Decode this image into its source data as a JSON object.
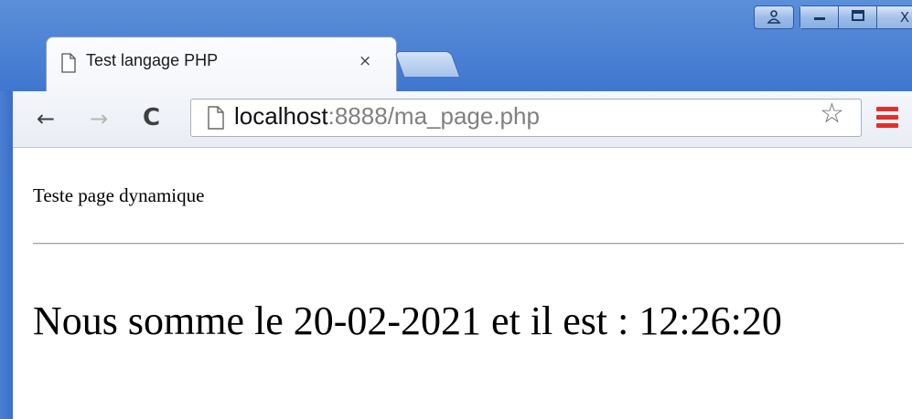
{
  "browser": {
    "tab": {
      "title": "Test langage PHP",
      "close_glyph": "×"
    },
    "url": {
      "host": "localhost",
      "rest": ":8888/ma_page.php"
    },
    "icons": {
      "back": "←",
      "forward": "→",
      "reload": "C",
      "star": "☆",
      "user": "user-icon",
      "minimize": "minimize-icon",
      "maximize": "maximize-icon",
      "close": "close-icon",
      "page": "page-icon",
      "menu": "menu-icon"
    },
    "caption_glyphs": {
      "user": "👤",
      "minimize": "▁",
      "maximize": "▢",
      "close": "X"
    },
    "colors": {
      "frame": "#3f77cf",
      "menu": "#e0302c"
    }
  },
  "page": {
    "heading": "Teste page dynamique",
    "message": "Nous somme le 20-02-2021 et il est : 12:26:20"
  }
}
